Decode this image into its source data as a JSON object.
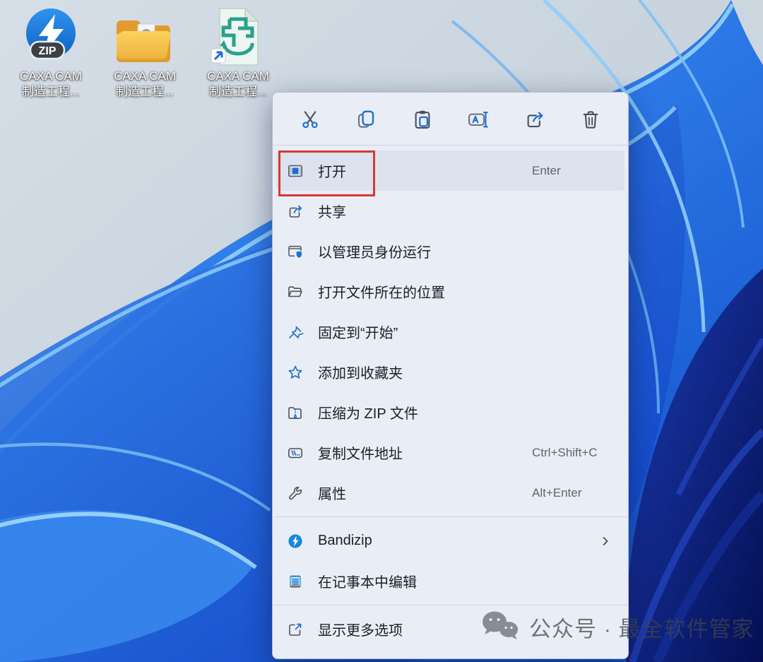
{
  "desktop": {
    "icons": [
      {
        "type": "zip-archive",
        "badge": "ZIP",
        "label_line1": "CAXA CAM",
        "label_line2": "制造工程..."
      },
      {
        "type": "folder",
        "label_line1": "CAXA CAM",
        "label_line2": "制造工程..."
      },
      {
        "type": "caxa-shortcut",
        "label_line1": "CAXA CAM",
        "label_line2": "制造工程..."
      }
    ]
  },
  "context_menu": {
    "icon_bar": [
      {
        "name": "cut"
      },
      {
        "name": "copy"
      },
      {
        "name": "paste"
      },
      {
        "name": "rename"
      },
      {
        "name": "share"
      },
      {
        "name": "delete"
      }
    ],
    "items": [
      {
        "label": "打开",
        "shortcut": "Enter",
        "icon": "open-icon",
        "highlighted": true,
        "annotated": true
      },
      {
        "label": "共享",
        "icon": "share-icon"
      },
      {
        "label": "以管理员身份运行",
        "icon": "run-as-admin-icon"
      },
      {
        "label": "打开文件所在的位置",
        "icon": "folder-open-icon"
      },
      {
        "label": "固定到“开始”",
        "icon": "pin-icon"
      },
      {
        "label": "添加到收藏夹",
        "icon": "star-icon"
      },
      {
        "label": "压缩为 ZIP 文件",
        "icon": "zip-folder-icon"
      },
      {
        "label": "复制文件地址",
        "shortcut": "Ctrl+Shift+C",
        "icon": "copy-path-icon"
      },
      {
        "label": "属性",
        "shortcut": "Alt+Enter",
        "icon": "wrench-icon"
      },
      {
        "label": "Bandizip",
        "icon": "bandizip-icon",
        "has_submenu": true
      },
      {
        "label": "在记事本中编辑",
        "icon": "notepad-icon"
      },
      {
        "label": "显示更多选项",
        "icon": "show-more-options-icon"
      }
    ]
  },
  "watermark": {
    "text": "公众号 · 最全软件管家"
  },
  "colors": {
    "accent_blue": "#1f6fd0",
    "menu_background": "#e9edf6",
    "hover_row": "#dce2ee",
    "annotation_red": "#da3832",
    "shortcut_text": "#5c6570",
    "wallpaper_navy": "#050f52"
  }
}
